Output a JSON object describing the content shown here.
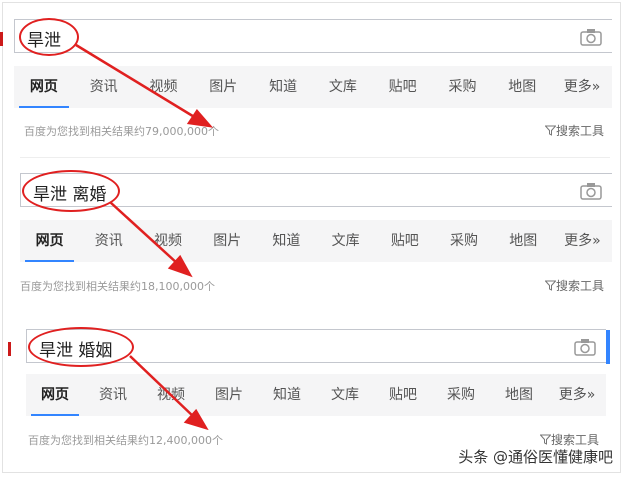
{
  "panels": [
    {
      "query": "旱泄",
      "tabs": [
        "网页",
        "资讯",
        "视频",
        "图片",
        "知道",
        "文库",
        "贴吧",
        "采购",
        "地图",
        "更多»"
      ],
      "result_count": "百度为您找到相关结果约79,000,000个",
      "tools_label": "搜索工具"
    },
    {
      "query": "旱泄 离婚",
      "tabs": [
        "网页",
        "资讯",
        "视频",
        "图片",
        "知道",
        "文库",
        "贴吧",
        "采购",
        "地图",
        "更多»"
      ],
      "result_count": "百度为您找到相关结果约18,100,000个",
      "tools_label": "搜索工具"
    },
    {
      "query": "旱泄 婚姻",
      "tabs": [
        "网页",
        "资讯",
        "视频",
        "图片",
        "知道",
        "文库",
        "贴吧",
        "采购",
        "地图",
        "更多»"
      ],
      "result_count": "百度为您找到相关结果约12,400,000个",
      "tools_label": "搜索工具"
    }
  ],
  "watermark": "头条 @通俗医懂健康吧",
  "colors": {
    "accent": "#3385ff",
    "annotation": "#e02020",
    "tab_bg": "#f5f5f6"
  },
  "icons": [
    "camera-icon",
    "filter-icon"
  ]
}
